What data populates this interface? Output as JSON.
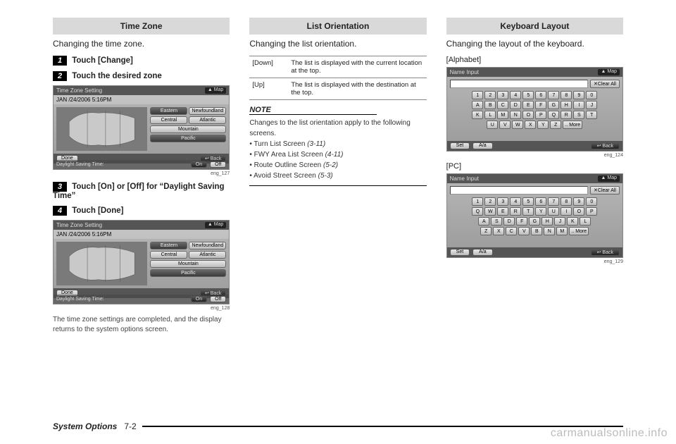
{
  "footer": {
    "section": "System Options",
    "page": "7-2"
  },
  "watermark": "carmanualsonline.info",
  "col1": {
    "header": "Time Zone",
    "intro": "Changing the time zone.",
    "step1": "Touch [Change]",
    "step2": "Touch the desired zone",
    "step3": "Touch [On] or [Off] for “Daylight Saving Time”",
    "step4": "Touch [Done]",
    "cap1": "eng_127",
    "cap2": "eng_128",
    "endnote": "The time zone settings are completed, and the display returns to the system options screen."
  },
  "tz": {
    "title": "Time Zone Setting",
    "map": "Map",
    "date": "JAN /24/2006     5:16PM",
    "zones": [
      "Eastern",
      "Newfoundland",
      "Central",
      "Atlantic",
      "Mountain",
      "Pacific"
    ],
    "dst_label": "Daylight Saving Time:",
    "on": "On",
    "off": "Off",
    "done": "Done",
    "back": "Back"
  },
  "col2": {
    "header": "List Orientation",
    "intro": "Changing the list orientation.",
    "row1k": "[Down]",
    "row1v": "The list is displayed with the current location at the top.",
    "row2k": "[Up]",
    "row2v": "The list is displayed with the destination at the top.",
    "note": "NOTE",
    "note_intro": "Changes to the list orientation apply to the following screens.",
    "b1a": "Turn List Screen ",
    "b1b": "(3-11)",
    "b2a": "FWY Area List Screen ",
    "b2b": "(4-11)",
    "b3a": "Route Outline Screen ",
    "b3b": "(5-2)",
    "b4a": "Avoid Street Screen ",
    "b4b": "(5-3)"
  },
  "col3": {
    "header": "Keyboard Layout",
    "intro": "Changing the layout of the keyboard.",
    "alpha": "[Alphabet]",
    "pc": "[PC]",
    "cap1": "eng_124",
    "cap2": "eng_129"
  },
  "kb": {
    "title": "Name Input",
    "map": "Map",
    "clear": "Clear All",
    "set": "Set",
    "shift": "A/a",
    "more": "More",
    "back": "Back",
    "rows_alpha": [
      [
        "1",
        "2",
        "3",
        "4",
        "5",
        "6",
        "7",
        "8",
        "9",
        "0"
      ],
      [
        "A",
        "B",
        "C",
        "D",
        "E",
        "F",
        "G",
        "H",
        "I",
        "J"
      ],
      [
        "K",
        "L",
        "M",
        "N",
        "O",
        "P",
        "Q",
        "R",
        "S",
        "T"
      ],
      [
        "U",
        "V",
        "W",
        "X",
        "Y",
        "Z"
      ]
    ],
    "rows_pc": [
      [
        "1",
        "2",
        "3",
        "4",
        "5",
        "6",
        "7",
        "8",
        "9",
        "0"
      ],
      [
        "Q",
        "W",
        "E",
        "R",
        "T",
        "Y",
        "U",
        "I",
        "O",
        "P"
      ],
      [
        "A",
        "S",
        "D",
        "F",
        "G",
        "H",
        "J",
        "K",
        "L"
      ],
      [
        "Z",
        "X",
        "C",
        "V",
        "B",
        "N",
        "M"
      ]
    ]
  }
}
